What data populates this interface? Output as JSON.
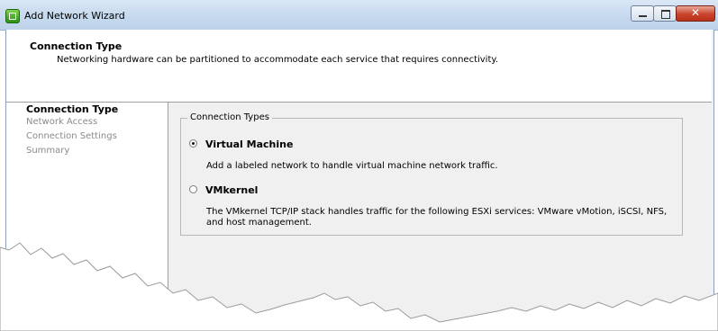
{
  "window": {
    "title": "Add Network Wizard"
  },
  "header": {
    "title": "Connection Type",
    "subtitle": "Networking hardware can be partitioned to accommodate each service that requires connectivity."
  },
  "nav": {
    "items": [
      {
        "label": "Connection Type",
        "active": true
      },
      {
        "label": "Network Access",
        "active": false
      },
      {
        "label": "Connection Settings",
        "active": false
      },
      {
        "label": "Summary",
        "active": false
      }
    ]
  },
  "connection_types": {
    "legend": "Connection Types",
    "options": [
      {
        "label": "Virtual Machine",
        "selected": true,
        "description": "Add a labeled network to handle virtual machine network traffic."
      },
      {
        "label": "VMkernel",
        "selected": false,
        "description": "The VMkernel TCP/IP stack handles traffic for the following ESXi services: VMware vMotion, iSCSI, NFS, and host management."
      }
    ]
  },
  "icons": {
    "app": "wizard-app-icon",
    "minimize": "minimize-icon",
    "maximize": "maximize-icon",
    "close": "close-icon"
  }
}
